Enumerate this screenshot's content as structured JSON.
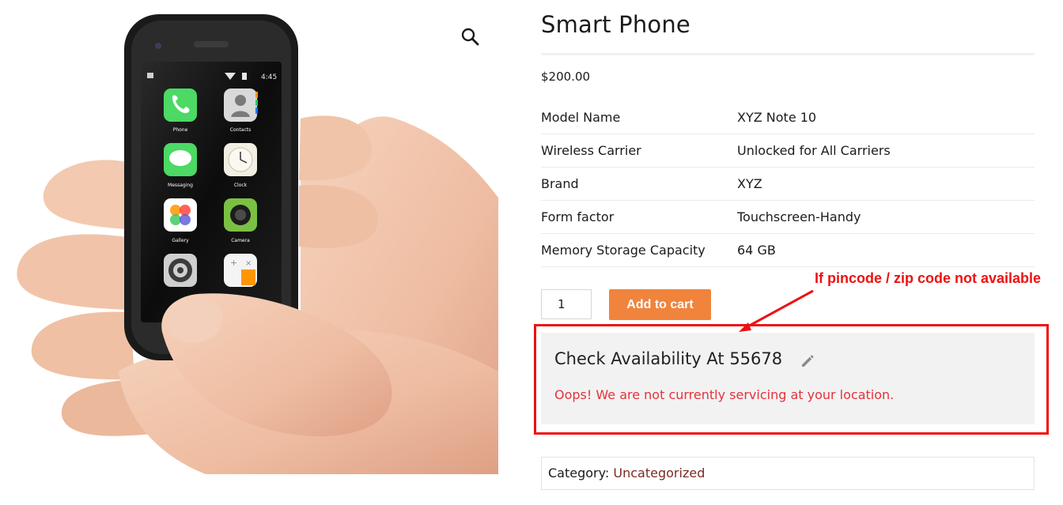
{
  "product": {
    "title": "Smart Phone",
    "price": "$200.00",
    "zoom_icon": "magnifier-icon",
    "image": {
      "status_time": "4:45",
      "apps": [
        {
          "label": "Phone",
          "icon": "phone-app-icon",
          "color": "#4cd964"
        },
        {
          "label": "Contacts",
          "icon": "contacts-app-icon",
          "color": "#d9d9d9"
        },
        {
          "label": "Messaging",
          "icon": "messaging-app-icon",
          "color": "#4cd964"
        },
        {
          "label": "Clock",
          "icon": "clock-app-icon",
          "color": "#f2eee3"
        },
        {
          "label": "Gallery",
          "icon": "gallery-app-icon",
          "color": "#ffffff"
        },
        {
          "label": "Camera",
          "icon": "camera-app-icon",
          "color": "#7bc043"
        },
        {
          "label": "Settings",
          "icon": "settings-app-icon",
          "color": "#cfcfcf"
        },
        {
          "label": "",
          "icon": "calculator-app-icon",
          "color": "#f4f4f4"
        }
      ]
    }
  },
  "attributes": [
    {
      "key": "Model Name",
      "value": "XYZ Note 10"
    },
    {
      "key": "Wireless Carrier",
      "value": "Unlocked for All Carriers"
    },
    {
      "key": "Brand",
      "value": "XYZ"
    },
    {
      "key": "Form factor",
      "value": "Touchscreen-Handy"
    },
    {
      "key": "Memory Storage Capacity",
      "value": "64 GB"
    }
  ],
  "cart": {
    "quantity": "1",
    "add_label": "Add to cart",
    "button_color": "#f0843c"
  },
  "availability": {
    "heading": "Check Availability At 55678",
    "edit_icon": "pencil-icon",
    "error": "Oops! We are not currently servicing at your location.",
    "error_color": "#e5323b"
  },
  "meta": {
    "category_label": "Category:",
    "category_value": "Uncategorized"
  },
  "annotation": {
    "text": "If pincode / zip code not available",
    "color": "#ee1111"
  }
}
